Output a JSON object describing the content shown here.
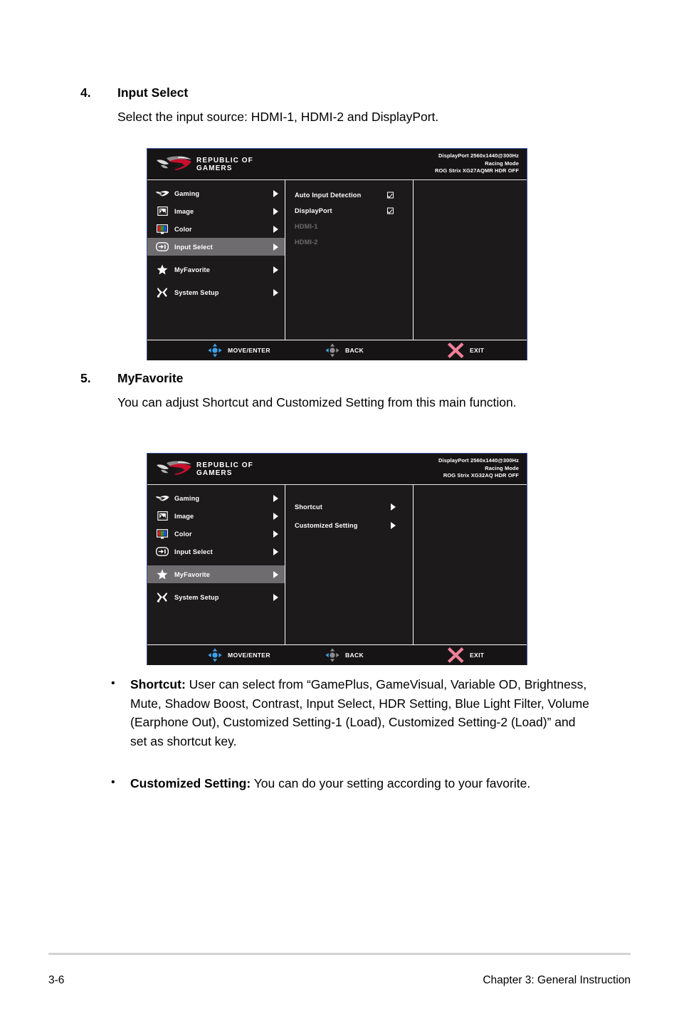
{
  "document": {
    "sections": [
      {
        "number": "4.",
        "heading": "Input Select",
        "paragraph": "Select the input source: HDMI-1, HDMI-2 and DisplayPort."
      },
      {
        "number": "5.",
        "heading": "MyFavorite",
        "paragraph": "You can adjust Shortcut and Customized Setting from this main function."
      }
    ],
    "bullets": [
      {
        "marker": "•",
        "term": "Shortcut:",
        "text": " User can select from “GamePlus, GameVisual, Variable OD, Brightness, Mute, Shadow Boost, Contrast, Input Select, HDR Setting, Blue Light Filter, Volume (Earphone Out), Customized Setting-1 (Load), Customized Setting-2 (Load)” and set as shortcut key."
      },
      {
        "marker": "•",
        "term": "Customized Setting:",
        "text": " You can do your setting according to your favorite."
      }
    ],
    "footer": {
      "page_number": "3-6",
      "chapter": "Chapter 3: General Instruction"
    }
  },
  "osd_common": {
    "brand_line1": "REPUBLIC OF",
    "brand_line2": "GAMERS",
    "nav": [
      {
        "label": "Gaming",
        "icon": "rog-eye-icon"
      },
      {
        "label": "Image",
        "icon": "picture-icon"
      },
      {
        "label": "Color",
        "icon": "rgb-monitor-icon"
      },
      {
        "label": "Input Select",
        "icon": "input-source-icon"
      },
      {
        "label": "MyFavorite",
        "icon": "star-icon"
      },
      {
        "label": "System Setup",
        "icon": "tools-icon"
      }
    ],
    "footer_buttons": [
      {
        "label": "MOVE/ENTER",
        "icon": "dpad-blue-icon"
      },
      {
        "label": "BACK",
        "icon": "dpad-gray-left-icon"
      },
      {
        "label": "EXIT",
        "icon": "close-x-icon"
      }
    ],
    "colors": {
      "osd_background": "#1c1a1b",
      "osd_border": "#3a51a0",
      "highlight": "#6e6c6f",
      "text": "#ffffff",
      "text_disabled": "#6d6b6c",
      "accent_blue": "#3ea0e8",
      "accent_pink": "#f08098",
      "rog_red": "#c8102e"
    }
  },
  "osd_input_select": {
    "mode_info": {
      "line1": "DisplayPort 2560x1440@300Hz",
      "line2": "Racing Mode",
      "line3": "ROG Strix XG27AQMR HDR OFF"
    },
    "selected_nav": "Input Select",
    "submenu": [
      {
        "label": "Auto Input Detection",
        "control": "checkbox",
        "checked": true,
        "enabled": true
      },
      {
        "label": "DisplayPort",
        "control": "checkbox",
        "checked": true,
        "enabled": true
      },
      {
        "label": "HDMI-1",
        "control": "none",
        "checked": false,
        "enabled": false
      },
      {
        "label": "HDMI-2",
        "control": "none",
        "checked": false,
        "enabled": false
      }
    ]
  },
  "osd_myfavorite": {
    "mode_info": {
      "line1": "DisplayPort 2560x1440@300Hz",
      "line2": "Racing Mode",
      "line3": "ROG Strix XG32AQ HDR OFF"
    },
    "selected_nav": "MyFavorite",
    "submenu": [
      {
        "label": "Shortcut",
        "control": "arrow",
        "enabled": true
      },
      {
        "label": "Customized Setting",
        "control": "arrow",
        "enabled": true
      }
    ]
  }
}
